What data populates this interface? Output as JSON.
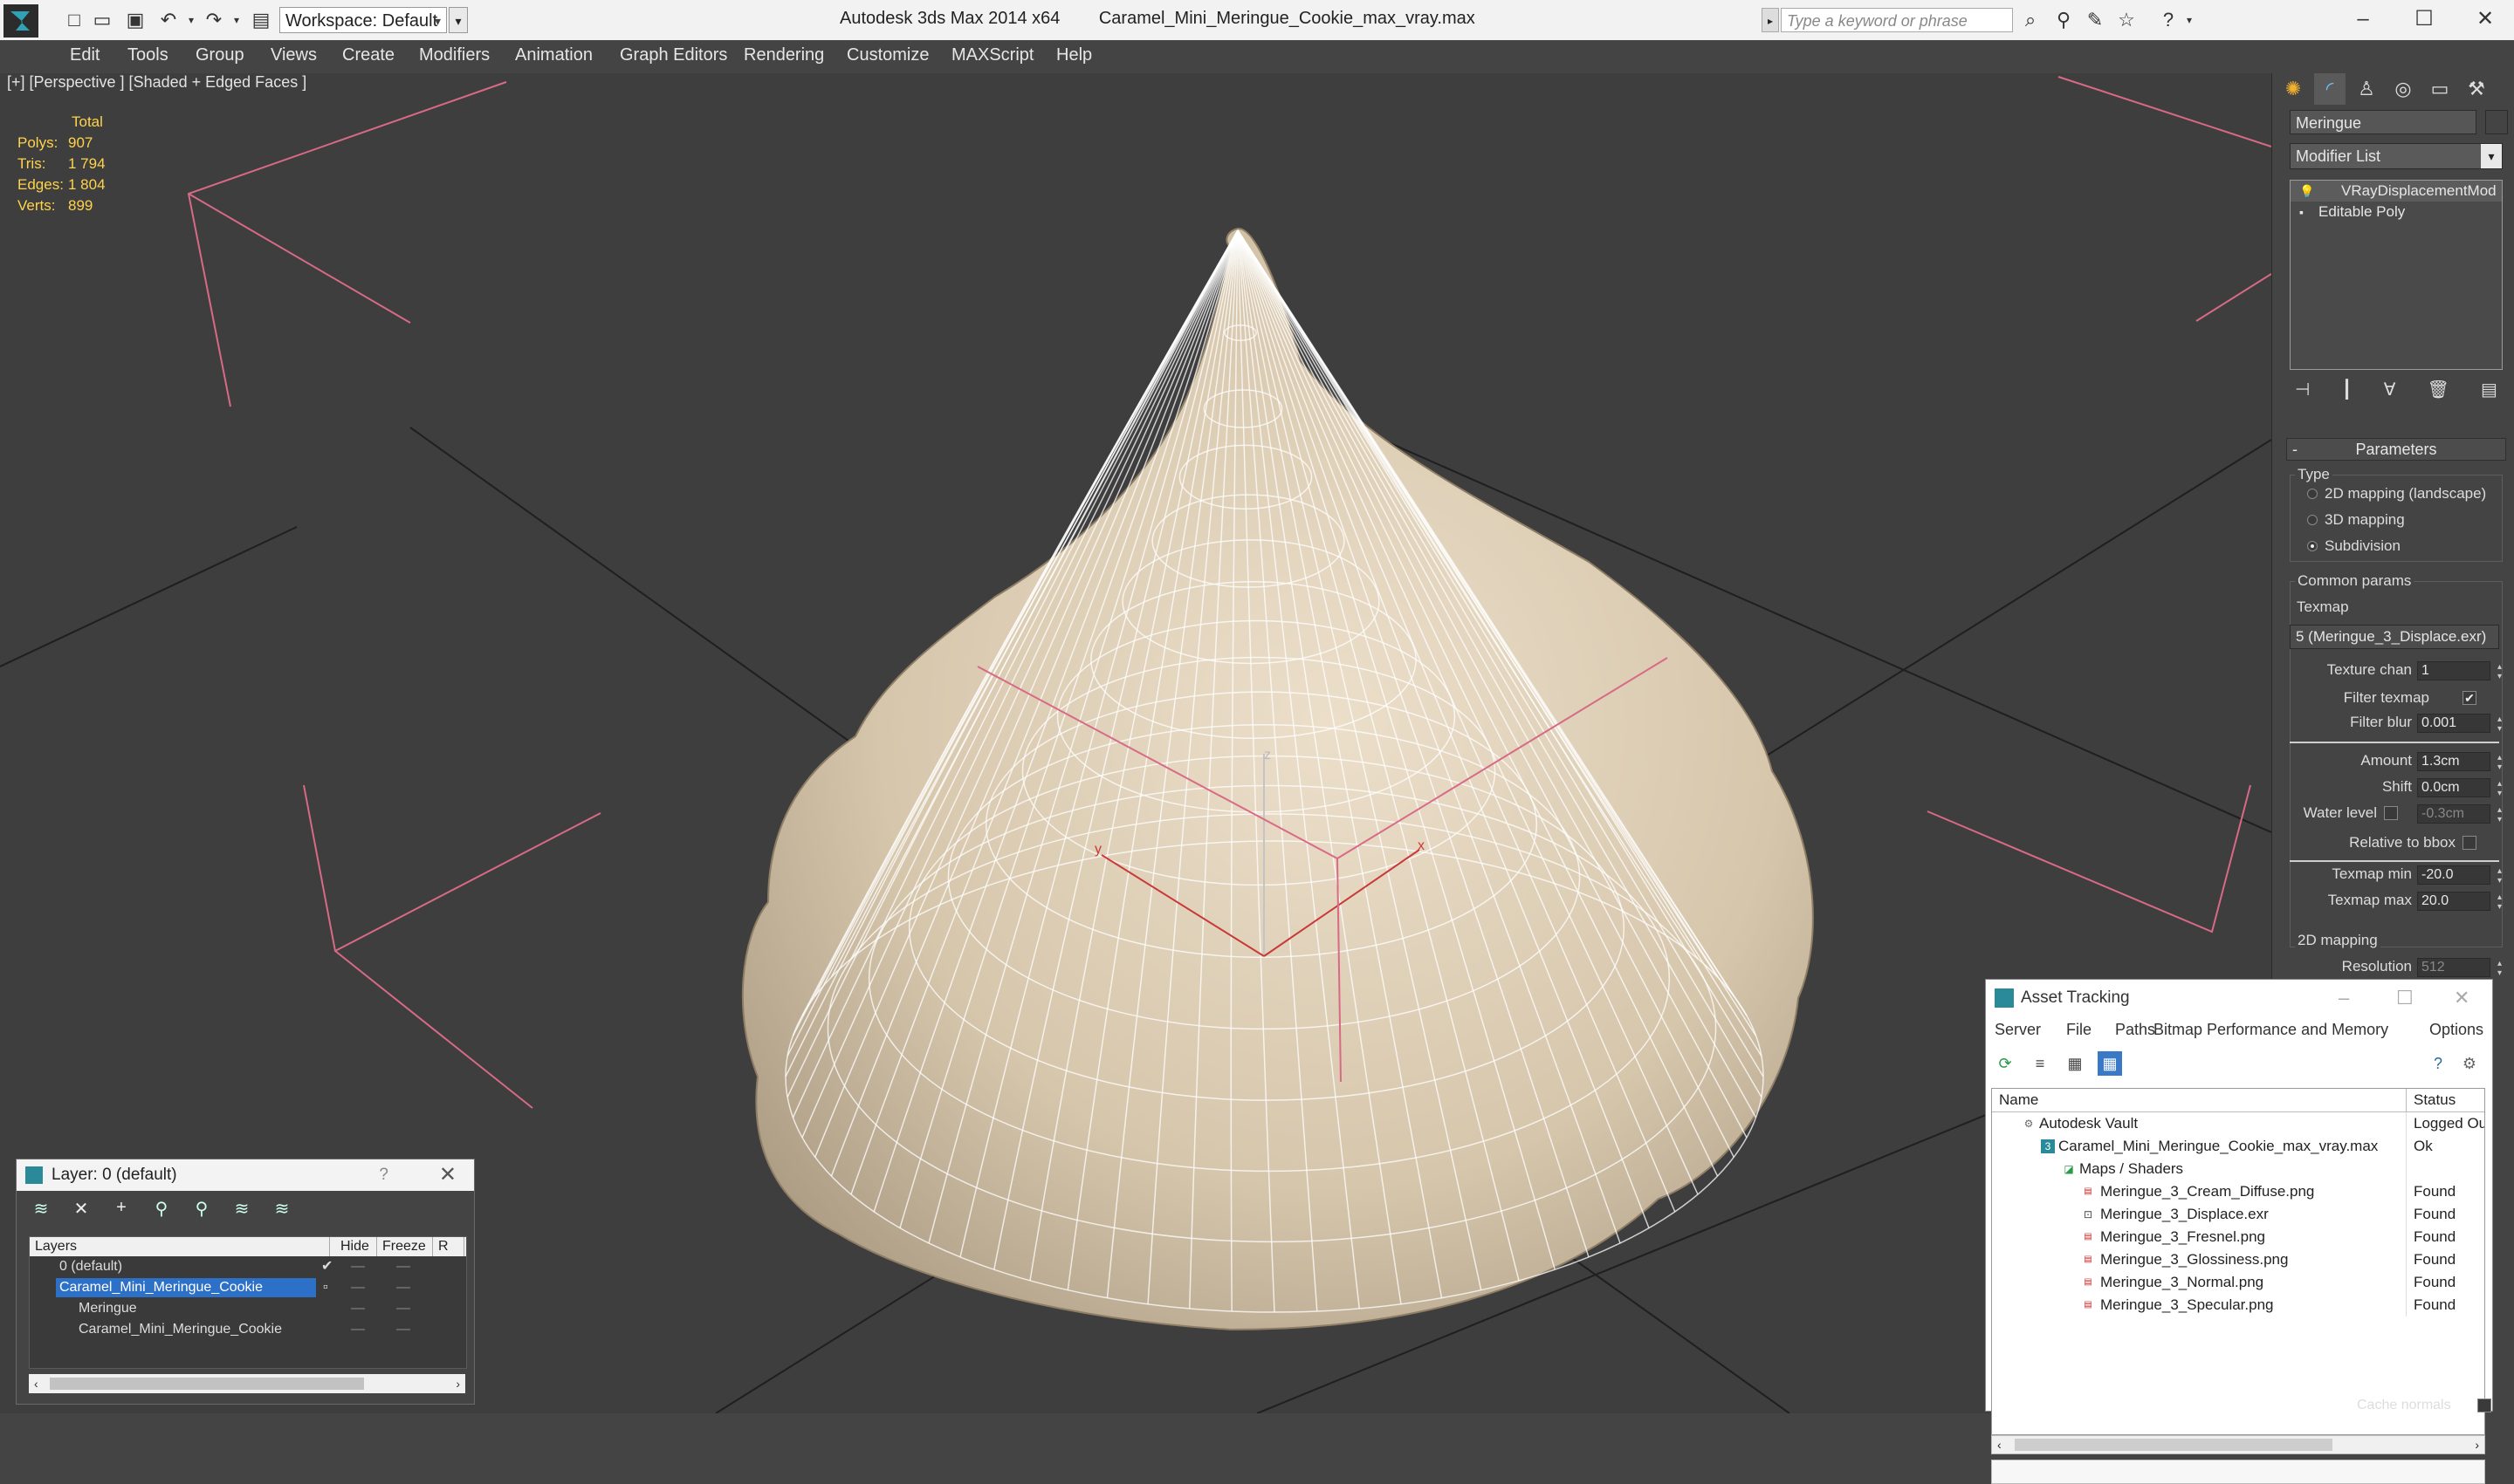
{
  "titlebar": {
    "app_title": "Autodesk 3ds Max  2014 x64",
    "file_name": "Caramel_Mini_Meringue_Cookie_max_vray.max",
    "workspace_label": "Workspace: Default",
    "search_placeholder": "Type a keyword or phrase"
  },
  "menu": [
    "Edit",
    "Tools",
    "Group",
    "Views",
    "Create",
    "Modifiers",
    "Animation",
    "Graph Editors",
    "Rendering",
    "Customize",
    "MAXScript",
    "Help"
  ],
  "viewport": {
    "label": "[+] [Perspective ] [Shaded + Edged Faces ]",
    "stats": {
      "header": "Total",
      "rows": [
        {
          "k": "Polys:",
          "v": "907"
        },
        {
          "k": "Tris:",
          "v": "1 794"
        },
        {
          "k": "Edges:",
          "v": "1 804"
        },
        {
          "k": "Verts:",
          "v": "899"
        }
      ]
    },
    "gizmo_labels": {
      "z": "z",
      "x": "x",
      "y": "y"
    },
    "colors": {
      "mesh": "#d9cbb4",
      "gizmo": "#d0505a",
      "background": "#3e3e3e"
    }
  },
  "command_panel": {
    "object_name": "Meringue",
    "modifier_list": "Modifier List",
    "stack": [
      "VRayDisplacementMod",
      "Editable Poly"
    ],
    "rollout": "Parameters",
    "type_group": "Type",
    "type_options": [
      "2D mapping (landscape)",
      "3D mapping",
      "Subdivision"
    ],
    "type_selected": "Subdivision",
    "common_group": "Common params",
    "texmap_label": "Texmap",
    "texmap_value": "5 (Meringue_3_Displace.exr)",
    "texture_chan_label": "Texture chan",
    "texture_chan": "1",
    "filter_texmap_label": "Filter texmap",
    "filter_texmap": true,
    "filter_blur_label": "Filter blur",
    "filter_blur": "0.001",
    "amount_label": "Amount",
    "amount": "1.3cm",
    "shift_label": "Shift",
    "shift": "0.0cm",
    "water_level_label": "Water level",
    "water_level": "-0.3cm",
    "relative_bbox_label": "Relative to bbox",
    "texmap_min_label": "Texmap min",
    "texmap_min": "-20.0",
    "texmap_max_label": "Texmap max",
    "texmap_max": "20.0",
    "mapping_2d_group": "2D mapping",
    "resolution_label": "Resolution",
    "resolution": "512",
    "cache_normals_label": "Cache normals"
  },
  "layer_window": {
    "title": "Layer: 0 (default)",
    "help": "?",
    "columns": [
      "Layers",
      "Hide",
      "Freeze",
      "R"
    ],
    "rows": [
      {
        "name": "0 (default)",
        "indent": 0,
        "selected": false
      },
      {
        "name": "Caramel_Mini_Meringue_Cookie",
        "indent": 0,
        "selected": true
      },
      {
        "name": "Meringue",
        "indent": 1,
        "selected": false
      },
      {
        "name": "Caramel_Mini_Meringue_Cookie",
        "indent": 1,
        "selected": false
      }
    ]
  },
  "asset_window": {
    "title": "Asset Tracking",
    "menu": [
      "Server",
      "File",
      "Paths",
      "Bitmap Performance and Memory",
      "Options"
    ],
    "columns": [
      "Name",
      "Status"
    ],
    "rows": [
      {
        "name": "Autodesk Vault",
        "status": "Logged Ou",
        "indent": 0
      },
      {
        "name": "Caramel_Mini_Meringue_Cookie_max_vray.max",
        "status": "Ok",
        "indent": 1
      },
      {
        "name": "Maps / Shaders",
        "status": "",
        "indent": 2
      },
      {
        "name": "Meringue_3_Cream_Diffuse.png",
        "status": "Found",
        "indent": 3
      },
      {
        "name": "Meringue_3_Displace.exr",
        "status": "Found",
        "indent": 3
      },
      {
        "name": "Meringue_3_Fresnel.png",
        "status": "Found",
        "indent": 3
      },
      {
        "name": "Meringue_3_Glossiness.png",
        "status": "Found",
        "indent": 3
      },
      {
        "name": "Meringue_3_Normal.png",
        "status": "Found",
        "indent": 3
      },
      {
        "name": "Meringue_3_Specular.png",
        "status": "Found",
        "indent": 3
      }
    ]
  }
}
